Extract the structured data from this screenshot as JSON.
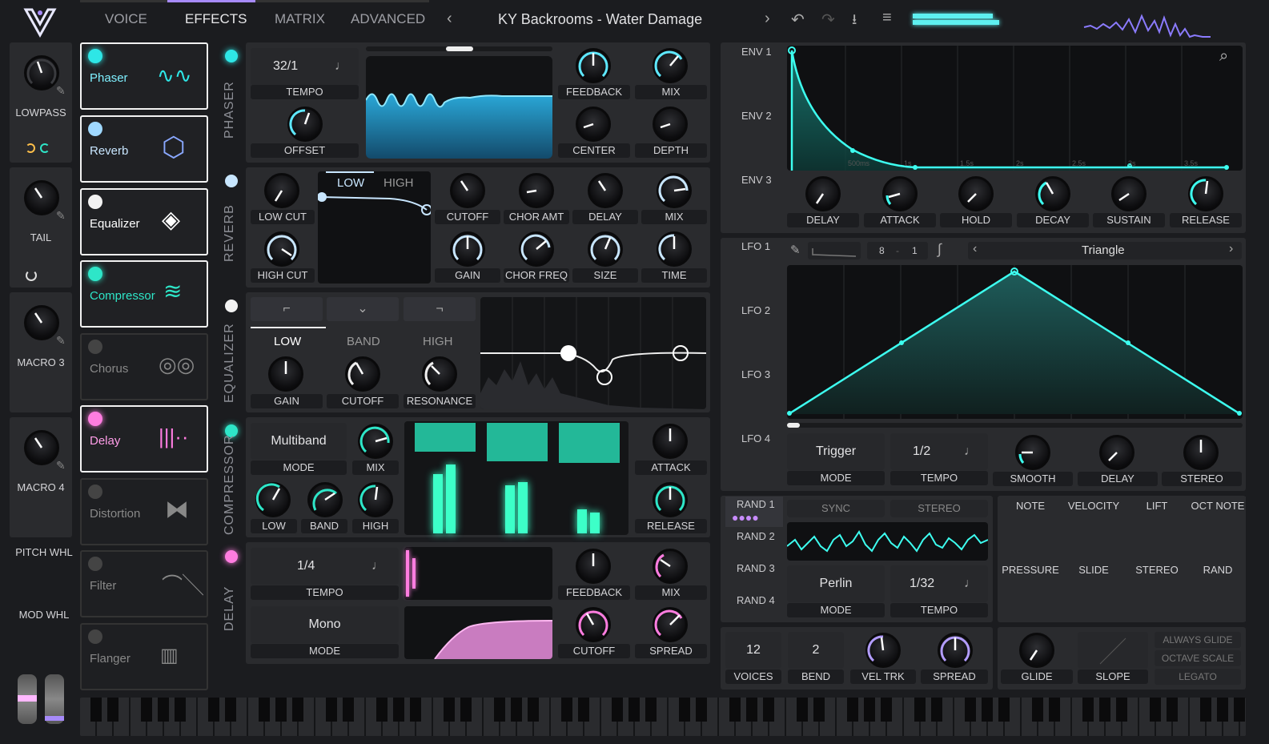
{
  "header": {
    "tabs": [
      "VOICE",
      "EFFECTS",
      "MATRIX",
      "ADVANCED"
    ],
    "active_tab": "EFFECTS",
    "preset": "KY Backrooms - Water Damage"
  },
  "macros": [
    {
      "label": "LOWPASS"
    },
    {
      "label": "TAIL"
    },
    {
      "label": "MACRO 3"
    },
    {
      "label": "MACRO 4"
    }
  ],
  "wheels": {
    "pitch": "PITCH WHL",
    "mod": "MOD WHL"
  },
  "effects": [
    {
      "name": "Phaser",
      "on": true,
      "color": "#2ee6e6"
    },
    {
      "name": "Reverb",
      "on": true,
      "color": "#9fd8ff"
    },
    {
      "name": "Equalizer",
      "on": true,
      "color": "#f2f2f2"
    },
    {
      "name": "Compressor",
      "on": true,
      "color": "#2ee6c8"
    },
    {
      "name": "Chorus",
      "on": false,
      "color": "#555"
    },
    {
      "name": "Delay",
      "on": true,
      "color": "#ff7de0"
    },
    {
      "name": "Distortion",
      "on": false,
      "color": "#555"
    },
    {
      "name": "Filter",
      "on": false,
      "color": "#555"
    },
    {
      "name": "Flanger",
      "on": false,
      "color": "#555"
    }
  ],
  "sections": {
    "phaser": "PHASER",
    "reverb": "REVERB",
    "equalizer": "EQUALIZER",
    "compressor": "COMPRESSOR",
    "delay": "DELAY"
  },
  "phaser": {
    "tempo_value": "32/1",
    "tempo": "TEMPO",
    "offset": "OFFSET",
    "feedback": "FEEDBACK",
    "mix": "MIX",
    "center": "CENTER",
    "depth": "DEPTH"
  },
  "reverb": {
    "low_cut": "LOW CUT",
    "high_cut": "HIGH CUT",
    "tab_low": "LOW",
    "tab_high": "HIGH",
    "cutoff": "CUTOFF",
    "chor_amt": "CHOR AMT",
    "delay": "DELAY",
    "mix": "MIX",
    "gain": "GAIN",
    "chor_freq": "CHOR FREQ",
    "size": "SIZE",
    "time": "TIME"
  },
  "eq": {
    "low": "LOW",
    "band": "BAND",
    "high": "HIGH",
    "gain": "GAIN",
    "cutoff": "CUTOFF",
    "resonance": "RESONANCE"
  },
  "compressor": {
    "mode_value": "Multiband",
    "mode": "MODE",
    "mix": "MIX",
    "low": "LOW",
    "band": "BAND",
    "high": "HIGH",
    "attack": "ATTACK",
    "release": "RELEASE"
  },
  "delay": {
    "tempo_value": "1/4",
    "tempo": "TEMPO",
    "mode_value": "Mono",
    "mode": "MODE",
    "feedback": "FEEDBACK",
    "mix": "MIX",
    "cutoff": "CUTOFF",
    "spread": "SPREAD"
  },
  "env": {
    "tabs": [
      "ENV 1",
      "ENV 2",
      "ENV 3"
    ],
    "times": [
      "500ms",
      "1s",
      "1.5s",
      "2s",
      "2.5s",
      "3s",
      "3.5s"
    ],
    "knobs": [
      "DELAY",
      "ATTACK",
      "HOLD",
      "DECAY",
      "SUSTAIN",
      "RELEASE"
    ]
  },
  "lfo": {
    "tabs": [
      "LFO 1",
      "LFO 2",
      "LFO 3",
      "LFO 4"
    ],
    "grid_x": "8",
    "grid_y": "1",
    "shape": "Triangle",
    "mode_value": "Trigger",
    "mode": "MODE",
    "tempo_value": "1/2",
    "tempo": "TEMPO",
    "smooth": "SMOOTH",
    "delay": "DELAY",
    "stereo": "STEREO"
  },
  "rand": {
    "tabs": [
      "RAND 1",
      "RAND 2",
      "RAND 3",
      "RAND 4"
    ],
    "sync": "SYNC",
    "stereo": "STEREO",
    "mode_value": "Perlin",
    "mode": "MODE",
    "tempo_value": "1/32",
    "tempo": "TEMPO"
  },
  "mod_sources": [
    "NOTE",
    "VELOCITY",
    "LIFT",
    "OCT NOTE",
    "PRESSURE",
    "SLIDE",
    "STEREO",
    "RAND"
  ],
  "voice": {
    "voices_value": "12",
    "voices": "VOICES",
    "bend_value": "2",
    "bend": "BEND",
    "vel_trk": "VEL TRK",
    "spread": "SPREAD",
    "glide": "GLIDE",
    "slope": "SLOPE",
    "always_glide": "ALWAYS GLIDE",
    "octave_scale": "OCTAVE SCALE",
    "legato": "LEGATO"
  }
}
